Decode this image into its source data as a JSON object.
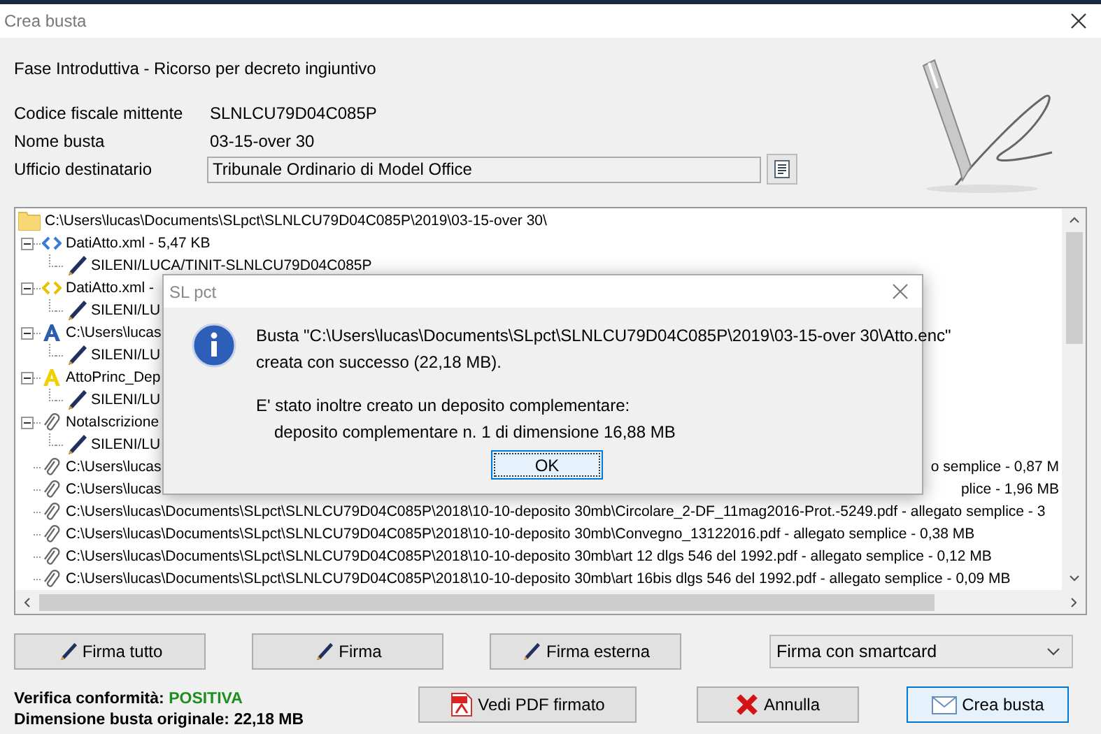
{
  "window": {
    "title": "Crea busta"
  },
  "header": {
    "phase": "Fase Introduttiva - Ricorso per decreto ingiuntivo",
    "fields": [
      {
        "label": "Codice fiscale mittente",
        "value": "SLNLCU79D04C085P",
        "kind": "text"
      },
      {
        "label": "Nome busta",
        "value": "03-15-over 30",
        "kind": "text"
      },
      {
        "label": "Ufficio destinatario",
        "value": "Tribunale Ordinario di Model Office",
        "kind": "field"
      }
    ]
  },
  "tree": {
    "label": "C:\\Users\\lucas\\Documents\\SLpct\\SLNLCU79D04C085P\\2019\\03-15-over 30\\",
    "kind": "folder",
    "children": [
      {
        "label": "DatiAtto.xml - 5,47 KB",
        "kind": "xml_blue",
        "expanded": true,
        "children": [
          {
            "label": "SILENI/LUCA/TINIT-SLNLCU79D04C085P",
            "kind": "sign"
          }
        ]
      },
      {
        "label": "DatiAtto.xml -",
        "kind": "xml_yellow",
        "expanded": true,
        "children": [
          {
            "label": "SILENI/LU",
            "kind": "sign"
          }
        ]
      },
      {
        "label": "C:\\Users\\lucas",
        "kind": "font_blue",
        "expanded": true,
        "children": [
          {
            "label": "SILENI/LU",
            "kind": "sign"
          }
        ]
      },
      {
        "label": "AttoPrinc_Dep",
        "kind": "font_yellow",
        "expanded": true,
        "children": [
          {
            "label": "SILENI/LU",
            "kind": "sign"
          }
        ]
      },
      {
        "label": "NotaIscrizione",
        "kind": "clip",
        "expanded": true,
        "children": [
          {
            "label": "SILENI/LU",
            "kind": "sign"
          }
        ]
      },
      {
        "label": "C:\\Users\\lucas",
        "tail": "o semplice - 0,87 M",
        "kind": "clip"
      },
      {
        "label": "C:\\Users\\lucas",
        "tail": "plice - 1,96 MB",
        "kind": "clip"
      },
      {
        "label": "C:\\Users\\lucas\\Documents\\SLpct\\SLNLCU79D04C085P\\2018\\10-10-deposito 30mb\\Circolare_2-DF_11mag2016-Prot.-5249.pdf - allegato semplice - 3",
        "kind": "clip"
      },
      {
        "label": "C:\\Users\\lucas\\Documents\\SLpct\\SLNLCU79D04C085P\\2018\\10-10-deposito 30mb\\Convegno_13122016.pdf - allegato semplice - 0,38 MB",
        "kind": "clip"
      },
      {
        "label": "C:\\Users\\lucas\\Documents\\SLpct\\SLNLCU79D04C085P\\2018\\10-10-deposito 30mb\\art 12 dlgs 546 del 1992.pdf - allegato semplice - 0,12 MB",
        "kind": "clip"
      },
      {
        "label": "C:\\Users\\lucas\\Documents\\SLpct\\SLNLCU79D04C085P\\2018\\10-10-deposito 30mb\\art 16bis dlgs 546 del 1992.pdf - allegato semplice - 0,09 MB",
        "kind": "clip"
      }
    ]
  },
  "dialog": {
    "title": "SL pct",
    "message_lines": [
      "Busta \"C:\\Users\\lucas\\Documents\\SLpct\\SLNLCU79D04C085P\\2019\\03-15-over 30\\Atto.enc\"",
      "creata con successo (22,18 MB)."
    ],
    "detail_title": "E' stato inoltre creato un deposito complementare:",
    "detail_line": "deposito complementare n. 1 di dimensione 16,88 MB",
    "ok": "OK"
  },
  "sign_buttons": [
    "Firma tutto",
    "Firma",
    "Firma esterna"
  ],
  "sign_mode": {
    "value": "Firma con smartcard"
  },
  "verification": {
    "label": "Verifica conformità:",
    "result": "POSITIVA",
    "size": "Dimensione busta originale: 22,18 MB"
  },
  "actions": [
    {
      "label": "Vedi PDF firmato",
      "kind": "pdf",
      "default": false
    },
    {
      "label": "Annulla",
      "kind": "cancel",
      "default": false
    },
    {
      "label": "Crea busta",
      "kind": "mail",
      "default": true
    }
  ]
}
